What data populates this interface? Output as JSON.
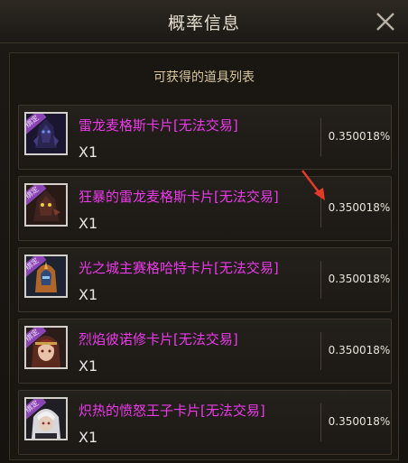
{
  "window": {
    "title": "概率信息"
  },
  "panel": {
    "subtitle": "可获得的道具列表"
  },
  "colors": {
    "item_name": "#ec39ea",
    "annotation_arrow": "#e53a2a",
    "bound_tag": "#8a44b3"
  },
  "items": [
    {
      "name": "雷龙麦格斯卡片[无法交易]",
      "quantity": "X1",
      "probability": "0.350018%",
      "tag": "绑定",
      "icon": "dark-dragon-card-icon"
    },
    {
      "name": "狂暴的雷龙麦格斯卡片[无法交易]",
      "quantity": "X1",
      "probability": "0.350018%",
      "tag": "绑定",
      "icon": "berserk-dragon-card-icon"
    },
    {
      "name": "光之城主赛格哈特卡片[无法交易]",
      "quantity": "X1",
      "probability": "0.350018%",
      "tag": "绑定",
      "icon": "knight-helmet-card-icon"
    },
    {
      "name": "烈焰彼诺修卡片[无法交易]",
      "quantity": "X1",
      "probability": "0.350018%",
      "tag": "绑定",
      "icon": "flame-girl-card-icon"
    },
    {
      "name": "炽热的愤怒王子卡片[无法交易]",
      "quantity": "X1",
      "probability": "0.350018%",
      "tag": "绑定",
      "icon": "white-hair-prince-card-icon"
    }
  ]
}
